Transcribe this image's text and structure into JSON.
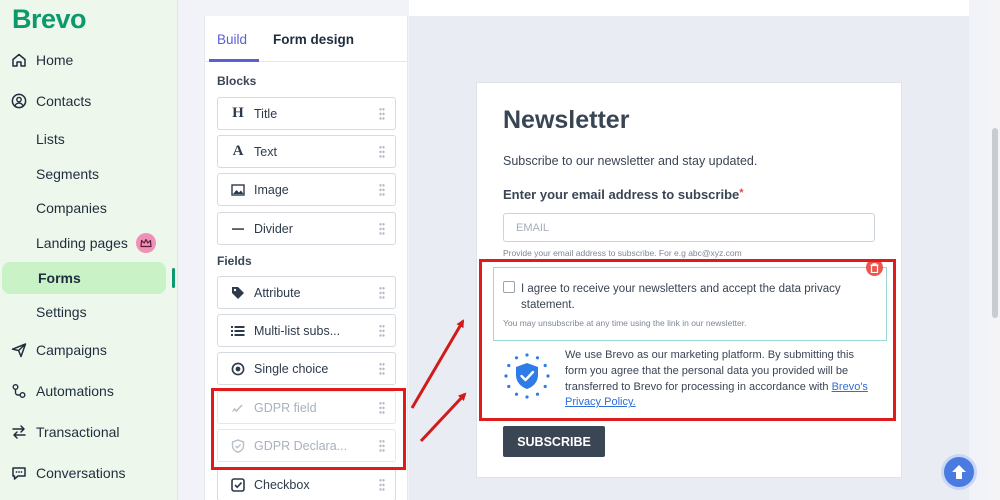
{
  "app": {
    "logo": "Brevo"
  },
  "sidebar": {
    "items": [
      {
        "label": "Home"
      },
      {
        "label": "Contacts"
      },
      {
        "label": "Lists"
      },
      {
        "label": "Segments"
      },
      {
        "label": "Companies"
      },
      {
        "label": "Landing pages"
      },
      {
        "label": "Forms"
      },
      {
        "label": "Settings"
      },
      {
        "label": "Campaigns"
      },
      {
        "label": "Automations"
      },
      {
        "label": "Transactional"
      },
      {
        "label": "Conversations"
      }
    ]
  },
  "builder": {
    "tabs": [
      {
        "label": "Build"
      },
      {
        "label": "Form design"
      }
    ],
    "blocks_label": "Blocks",
    "blocks": [
      {
        "label": "Title"
      },
      {
        "label": "Text"
      },
      {
        "label": "Image"
      },
      {
        "label": "Divider"
      }
    ],
    "fields_label": "Fields",
    "fields": [
      {
        "label": "Attribute"
      },
      {
        "label": "Multi-list subs..."
      },
      {
        "label": "Single choice"
      },
      {
        "label": "GDPR field"
      },
      {
        "label": "GDPR Declara..."
      },
      {
        "label": "Checkbox"
      }
    ]
  },
  "form": {
    "title": "Newsletter",
    "subtitle": "Subscribe to our newsletter and stay updated.",
    "email_label": "Enter your email address to subscribe",
    "required_mark": "*",
    "email_placeholder": "EMAIL",
    "email_help": "Provide your email address to subscribe. For e.g abc@xyz.com",
    "gdpr_checkbox_text": "I agree to receive your newsletters and accept the data privacy statement.",
    "gdpr_note": "You may unsubscribe at any time using the link in our newsletter.",
    "declaration_text": "We use Brevo as our marketing platform. By submitting this form you agree that the personal data you provided will be transferred to Brevo for processing in accordance with ",
    "declaration_link": "Brevo's Privacy Policy.",
    "submit_label": "SUBSCRIBE"
  },
  "colors": {
    "brand": "#0b996e",
    "accent": "#5a5fd2",
    "highlight": "#e01b1b",
    "button": "#3b4655"
  }
}
